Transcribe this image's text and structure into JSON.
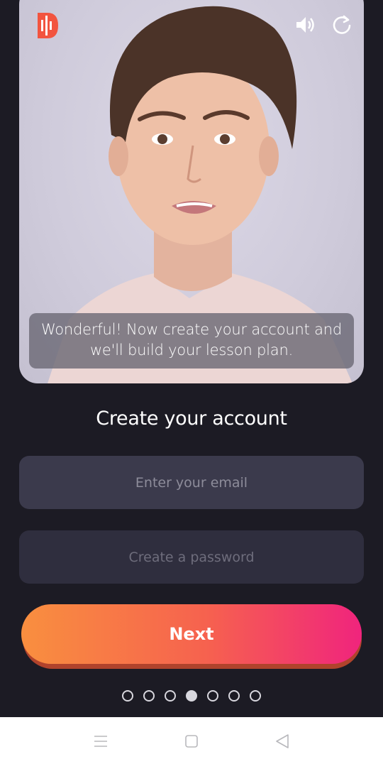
{
  "video": {
    "caption": "Wonderful! Now create your account and we'll build your lesson plan.",
    "logo_icon": "app-logo-icon",
    "speaker_icon": "speaker-icon",
    "replay_icon": "replay-icon"
  },
  "form": {
    "title": "Create your account",
    "email_placeholder": "Enter your email",
    "password_placeholder": "Create a password",
    "next_label": "Next"
  },
  "progress": {
    "total_steps": 7,
    "current_step": 4
  },
  "navbar": {
    "icons": [
      "menu-icon",
      "home-icon",
      "back-icon"
    ]
  },
  "colors": {
    "background": "#1c1b24",
    "button_start": "#f98f3f",
    "button_end": "#f0247d",
    "field": "#3b3a4c"
  }
}
